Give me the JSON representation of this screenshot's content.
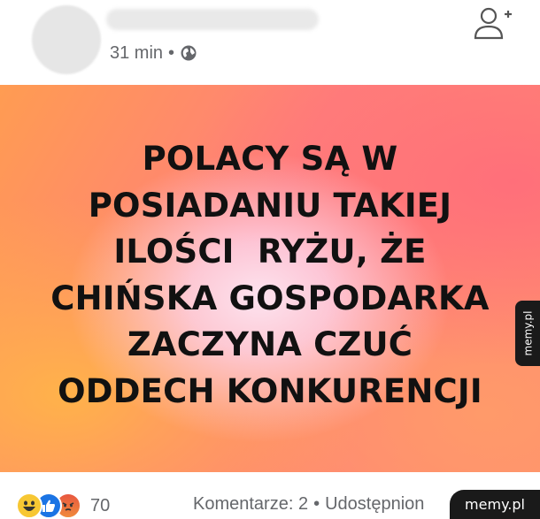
{
  "post": {
    "time": "31 min",
    "separator": "•",
    "privacy_icon": "globe-icon",
    "add_friend_icon": "add-friend-icon",
    "text_lines": [
      "POLACY SĄ W",
      "POSIADANIU TAKIEJ",
      "ILOŚCI  RYŻU, ŻE",
      "CHIŃSKA GOSPODARKA",
      "ZACZYNA CZUĆ",
      "ODDECH KONKURENCJI"
    ]
  },
  "footer": {
    "reaction_icons": [
      "laugh-reaction-icon",
      "like-reaction-icon",
      "angry-reaction-icon"
    ],
    "reaction_count": "70",
    "comments": "Komentarze: 2",
    "dot": "•",
    "shares": "Udostępnion"
  },
  "watermark": {
    "side": "memy.pl",
    "corner": "memy.pl"
  },
  "colors": {
    "meta_text": "#65676b",
    "like_blue": "#1b74e4",
    "laugh_yellow": "#f7c733"
  }
}
